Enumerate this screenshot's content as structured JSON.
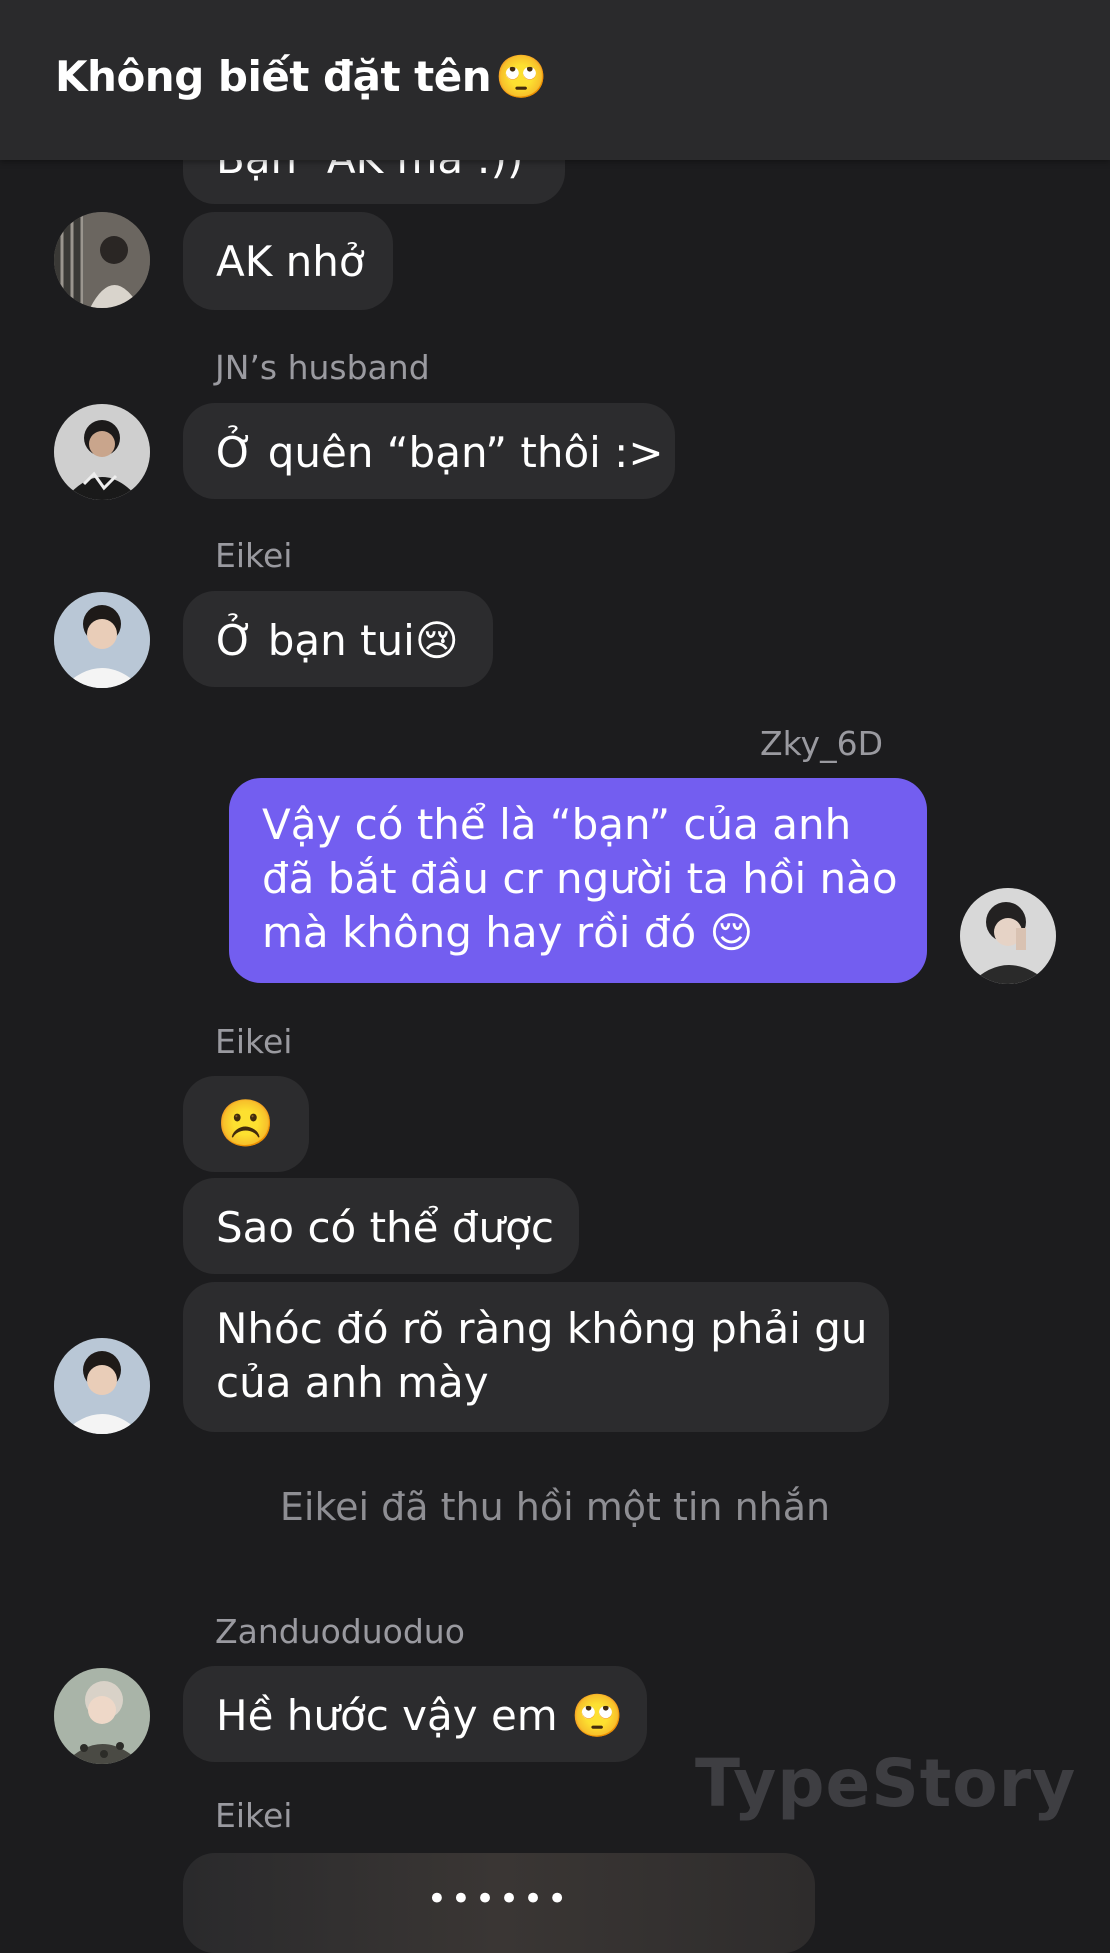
{
  "header": {
    "title": "Không biết đặt tên",
    "title_emoji": "🙄"
  },
  "messages": [
    {
      "text": "Bạn “AK mà :))",
      "partial": true
    },
    {
      "text": "AK nhở"
    },
    {
      "sender": "JN’s husband",
      "text": "Ở quên “bạn” thôi :>"
    },
    {
      "sender": "Eikei",
      "text": "Ở bạn tui",
      "emoji": "😢"
    },
    {
      "sender": "Zky_6D",
      "text": "Vậy có thể là “bạn” của anh đã bắt đầu cr người ta hồi nào mà không hay rồi đó",
      "emoji": "😌",
      "mine": true
    },
    {
      "sender": "Eikei",
      "emoji": "☹️"
    },
    {
      "text": "Sao có thể được"
    },
    {
      "text_lines": [
        "Nhóc đó rõ ràng không phải gu",
        "của anh mày"
      ]
    },
    {
      "sender": "Zanduoduoduo",
      "text": "Hề hước vậy em",
      "emoji": "🙄"
    },
    {
      "sender": "Eikei",
      "text": "••••••"
    }
  ],
  "system_note": "Eikei đã thu hồi một tin nhắn",
  "watermark": "TypeStory",
  "colors": {
    "background": "#1c1c1e",
    "header": "#2a2a2c",
    "bubble_other": "#2c2c2e",
    "bubble_mine": "#735ef0",
    "sender_name": "#9a9aa0"
  }
}
